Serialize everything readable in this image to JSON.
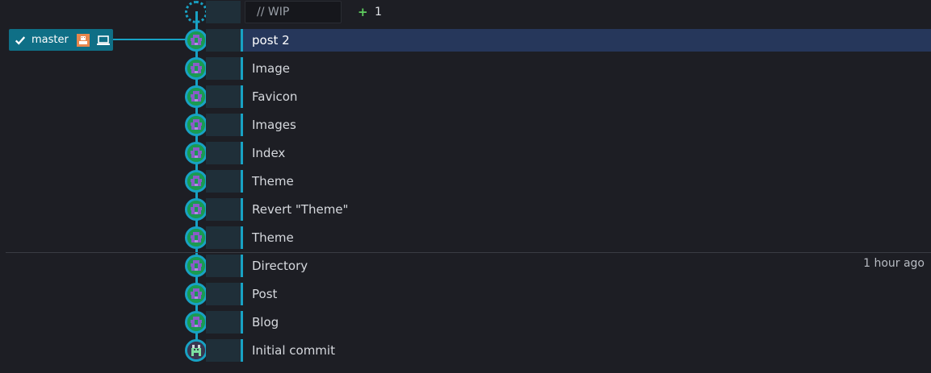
{
  "branch": {
    "name": "master",
    "active": true
  },
  "wip": {
    "placeholder": "// WIP",
    "added_count": "1",
    "add_symbol": "+"
  },
  "commits": [
    {
      "message": "post 2",
      "selected": true,
      "timestamp": ""
    },
    {
      "message": "Image",
      "timestamp": ""
    },
    {
      "message": "Favicon",
      "timestamp": ""
    },
    {
      "message": "Images",
      "timestamp": ""
    },
    {
      "message": "Index",
      "timestamp": ""
    },
    {
      "message": "Theme",
      "timestamp": ""
    },
    {
      "message": "Revert \"Theme\"",
      "timestamp": ""
    },
    {
      "message": "Theme",
      "timestamp": ""
    },
    {
      "message": "Directory",
      "timestamp": "1 hour ago"
    },
    {
      "message": "Post",
      "timestamp": ""
    },
    {
      "message": "Blog",
      "timestamp": ""
    },
    {
      "message": "Initial commit",
      "timestamp": ""
    }
  ],
  "colors": {
    "background": "#1d1e24",
    "graph_line": "#18a2c4",
    "selected_row": "#26375b",
    "branch_label": "#0f6f86",
    "add_green": "#5fcf5f",
    "avatar_green": "#1a9a52",
    "avatar_purple": "#8a5cc8"
  },
  "icons": {
    "branch_check": "check-icon",
    "branch_user": "user-avatar-icon",
    "branch_local": "laptop-icon",
    "commit_avatar": "identicon-avatar",
    "wip_node": "wip-node-icon"
  }
}
